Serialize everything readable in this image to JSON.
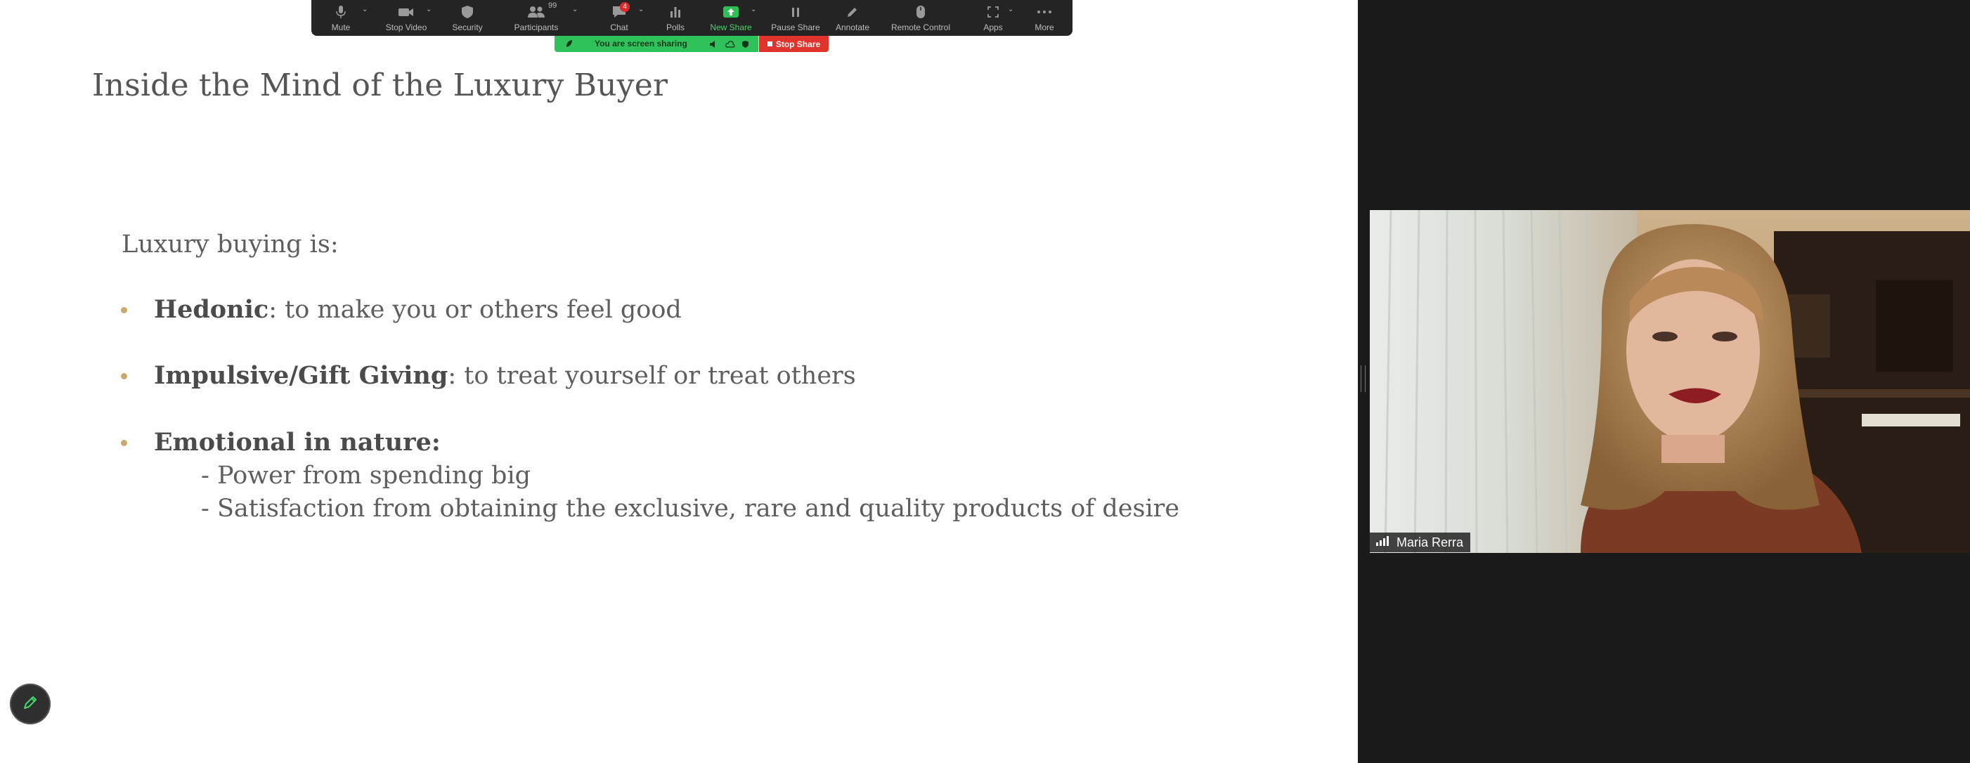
{
  "toolbar": {
    "mute_label": "Mute",
    "stop_video_label": "Stop Video",
    "security_label": "Security",
    "participants_label": "Participants",
    "participants_count": "99",
    "chat_label": "Chat",
    "chat_badge": "4",
    "polls_label": "Polls",
    "new_share_label": "New Share",
    "pause_share_label": "Pause Share",
    "annotate_label": "Annotate",
    "remote_control_label": "Remote Control",
    "apps_label": "Apps",
    "more_label": "More"
  },
  "share_banner": {
    "text": "You are screen sharing",
    "stop_label": "Stop Share",
    "color": "#30c25a",
    "stop_color": "#e0332b"
  },
  "slide": {
    "title": "Inside the Mind of the Luxury Buyer",
    "intro": "Luxury buying is:",
    "bullets": [
      {
        "bold": "Hedonic",
        "rest": ": to make you or others feel good"
      },
      {
        "bold": "Impulsive/Gift Giving",
        "rest": ": to treat yourself or treat others"
      },
      {
        "bold": "Emotional in nature:",
        "rest": ""
      }
    ],
    "sub_points": [
      "- Power from spending big",
      "- Satisfaction from obtaining the exclusive, rare and quality products of desire"
    ],
    "bullet_color": "#c8aa6e"
  },
  "participant": {
    "name": "Maria Rerra"
  },
  "icons": {
    "pen": "pencil-icon",
    "signal": "signal-bars-icon"
  }
}
